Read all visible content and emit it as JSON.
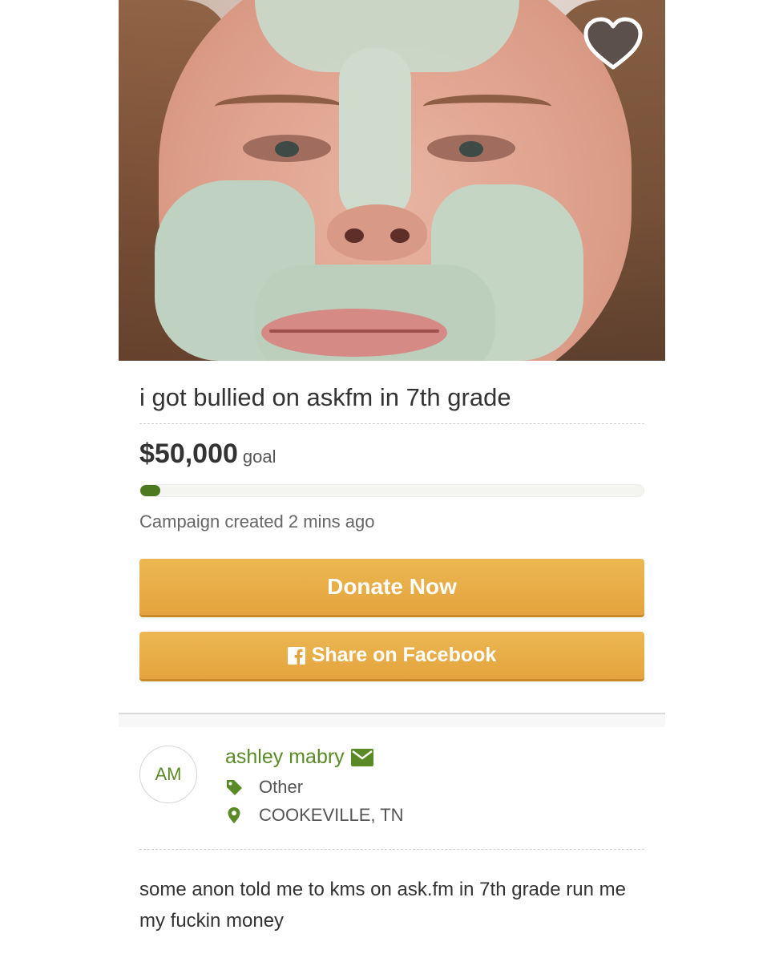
{
  "campaign": {
    "title": "i got bullied on askfm in 7th grade",
    "goal_amount": "$50,000",
    "goal_label": "goal",
    "progress_fraction": 0.04,
    "created_text": "Campaign created 2 mins ago"
  },
  "actions": {
    "donate_label": "Donate Now",
    "share_label": "Share on Facebook"
  },
  "organizer": {
    "initials": "AM",
    "name": "ashley mabry",
    "category": "Other",
    "location": "COOKEVILLE, TN"
  },
  "story": {
    "text": "some anon told me to kms on ask.fm in 7th grade run me my fuckin money"
  },
  "icons": {
    "favorite": "heart-icon",
    "facebook": "facebook-icon",
    "contact": "envelope-icon",
    "category": "tag-icon",
    "location": "map-pin-icon"
  },
  "colors": {
    "accent_green": "#5a8a25",
    "progress_green": "#4d7a1e",
    "button_orange": "#e4a43d"
  }
}
